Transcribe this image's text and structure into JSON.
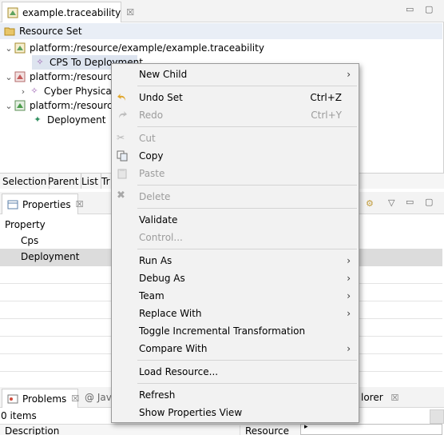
{
  "editor": {
    "tab_title": "example.traceability",
    "close": "☒",
    "root_label": "Resource Set",
    "tree": [
      {
        "label": "platform:/resource/example/example.traceability"
      },
      {
        "label": "CPS To Deployment"
      },
      {
        "label": "platform:/resource"
      },
      {
        "label": "Cyber Physical"
      },
      {
        "label": "platform:/resource"
      },
      {
        "label": "Deployment"
      }
    ],
    "bottom_tabs": [
      "Selection",
      "Parent",
      "List",
      "Tr"
    ]
  },
  "properties": {
    "tab_title": "Properties",
    "close": "☒",
    "header": "Property",
    "rows": [
      "Cps",
      "Deployment"
    ]
  },
  "bottom_panel": {
    "problems_tab": "Problems",
    "close": "☒",
    "partial_tab": "@ Jav",
    "explorer_tab": "lorer",
    "items_count": "0 items",
    "col_description": "Description",
    "col_resource": "Resource"
  },
  "context_menu": {
    "items": [
      {
        "label": "New Child",
        "submenu": true
      },
      {
        "label": "Undo Set",
        "accel": "Ctrl+Z",
        "icon": "undo-icon"
      },
      {
        "label": "Redo",
        "accel": "Ctrl+Y",
        "icon": "redo-icon",
        "disabled": true
      },
      {
        "label": "Cut",
        "icon": "cut-icon",
        "disabled": true
      },
      {
        "label": "Copy",
        "icon": "copy-icon"
      },
      {
        "label": "Paste",
        "icon": "paste-icon",
        "disabled": true
      },
      {
        "label": "Delete",
        "icon": "delete-icon",
        "disabled": true
      },
      {
        "label": "Validate"
      },
      {
        "label": "Control...",
        "disabled": true
      },
      {
        "label": "Run As",
        "submenu": true
      },
      {
        "label": "Debug As",
        "submenu": true
      },
      {
        "label": "Team",
        "submenu": true
      },
      {
        "label": "Replace With",
        "submenu": true
      },
      {
        "label": "Toggle Incremental Transformation"
      },
      {
        "label": "Compare With",
        "submenu": true
      },
      {
        "label": "Load Resource..."
      },
      {
        "label": "Refresh"
      },
      {
        "label": "Show Properties View"
      }
    ]
  },
  "colors": {
    "selection": "#dde4ef",
    "menu_bg": "#f2f2f2",
    "disabled": "#9c9c9c"
  }
}
